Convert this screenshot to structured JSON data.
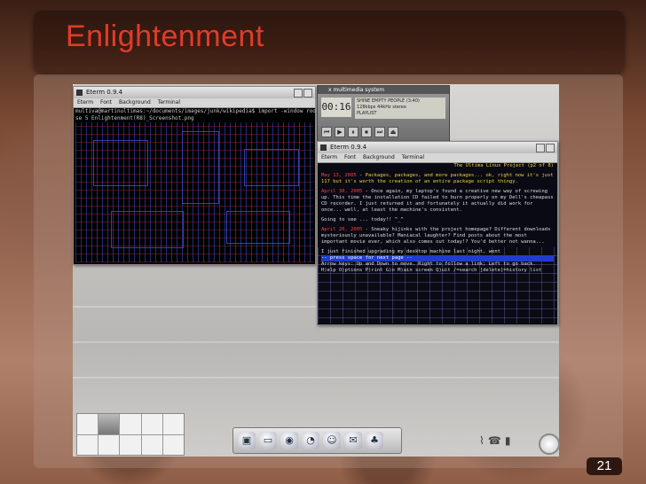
{
  "slide": {
    "title": "Enlightenment",
    "page_number": "21"
  },
  "eterm1": {
    "title": "Eterm 0.9.4",
    "menu": [
      "Eterm",
      "Font",
      "Background",
      "Terminal"
    ],
    "lines": [
      "multiva@martinultimas:~/documents/images/junk/wikipedia$ import -window root -pau",
      "se 5 Enlightenment(R8)_Screenshot.png"
    ]
  },
  "multimedia": {
    "title": "x multimedia system",
    "time": "00:16",
    "info_lines": [
      "SHINE EMPTY PEOPLE (3:40)",
      "128kbps 44kHz stereo",
      "PLAYLIST"
    ],
    "controls": [
      "⏮",
      "▶",
      "⏸",
      "⏹",
      "⏭",
      "⏏"
    ]
  },
  "eterm2": {
    "title": "Eterm 0.9.4",
    "menu": [
      "Eterm",
      "Font",
      "Background",
      "Terminal"
    ],
    "header": "The Ultima Linux Project (p2 of 8)",
    "entries": [
      {
        "date": "May 13, 2005",
        "text": "Packages, packages, and more packages... ok, right now it's just 117 but it's worth the creation of an entire package script thingy."
      },
      {
        "date": "April 30, 2005",
        "text": "Once again, my laptop's found a creative new way of screwing up. This time the installation CD failed to burn properly on my Dell's cheapass CD recorder. I just returned it and fortunately it actually did work for once... well, at least the machine's consistent."
      },
      {
        "date": "",
        "text": "Going to see ... today!! ^_^"
      },
      {
        "date": "April 20, 2005",
        "text": "Sneaky hijinks with the project homepage? Different downloads mysteriously unavailable? Maniacal laughter? Find posts about the most important movie ever, which also comes out today!? You'd better not wanna..."
      },
      {
        "date": "",
        "text": "I just finished upgrading my desktop machine last night, went"
      }
    ],
    "prompt": "-- press space for next page --",
    "help_lines": [
      "Arrow keys: Up and Down to move.  Right to follow a link; Left to go back.",
      "H)elp O)ptions P)rint G)o M)ain screen Q)uit /=search [delete]=history list"
    ]
  },
  "taskbar": {
    "icons": [
      "terminal-icon",
      "drive-icon",
      "globe-icon",
      "clock-icon",
      "chat-icon",
      "fish-icon",
      "gnome-icon"
    ],
    "glyphs": [
      "▣",
      "▭",
      "◉",
      "◔",
      "☺",
      "✉",
      "♣"
    ]
  },
  "tray": {
    "glyphs": [
      "⌇",
      "☎",
      "▮"
    ]
  },
  "colors": {
    "title_red": "#e23b2a",
    "title_bar": "#2d1710",
    "terminal_bg": "#000000"
  }
}
